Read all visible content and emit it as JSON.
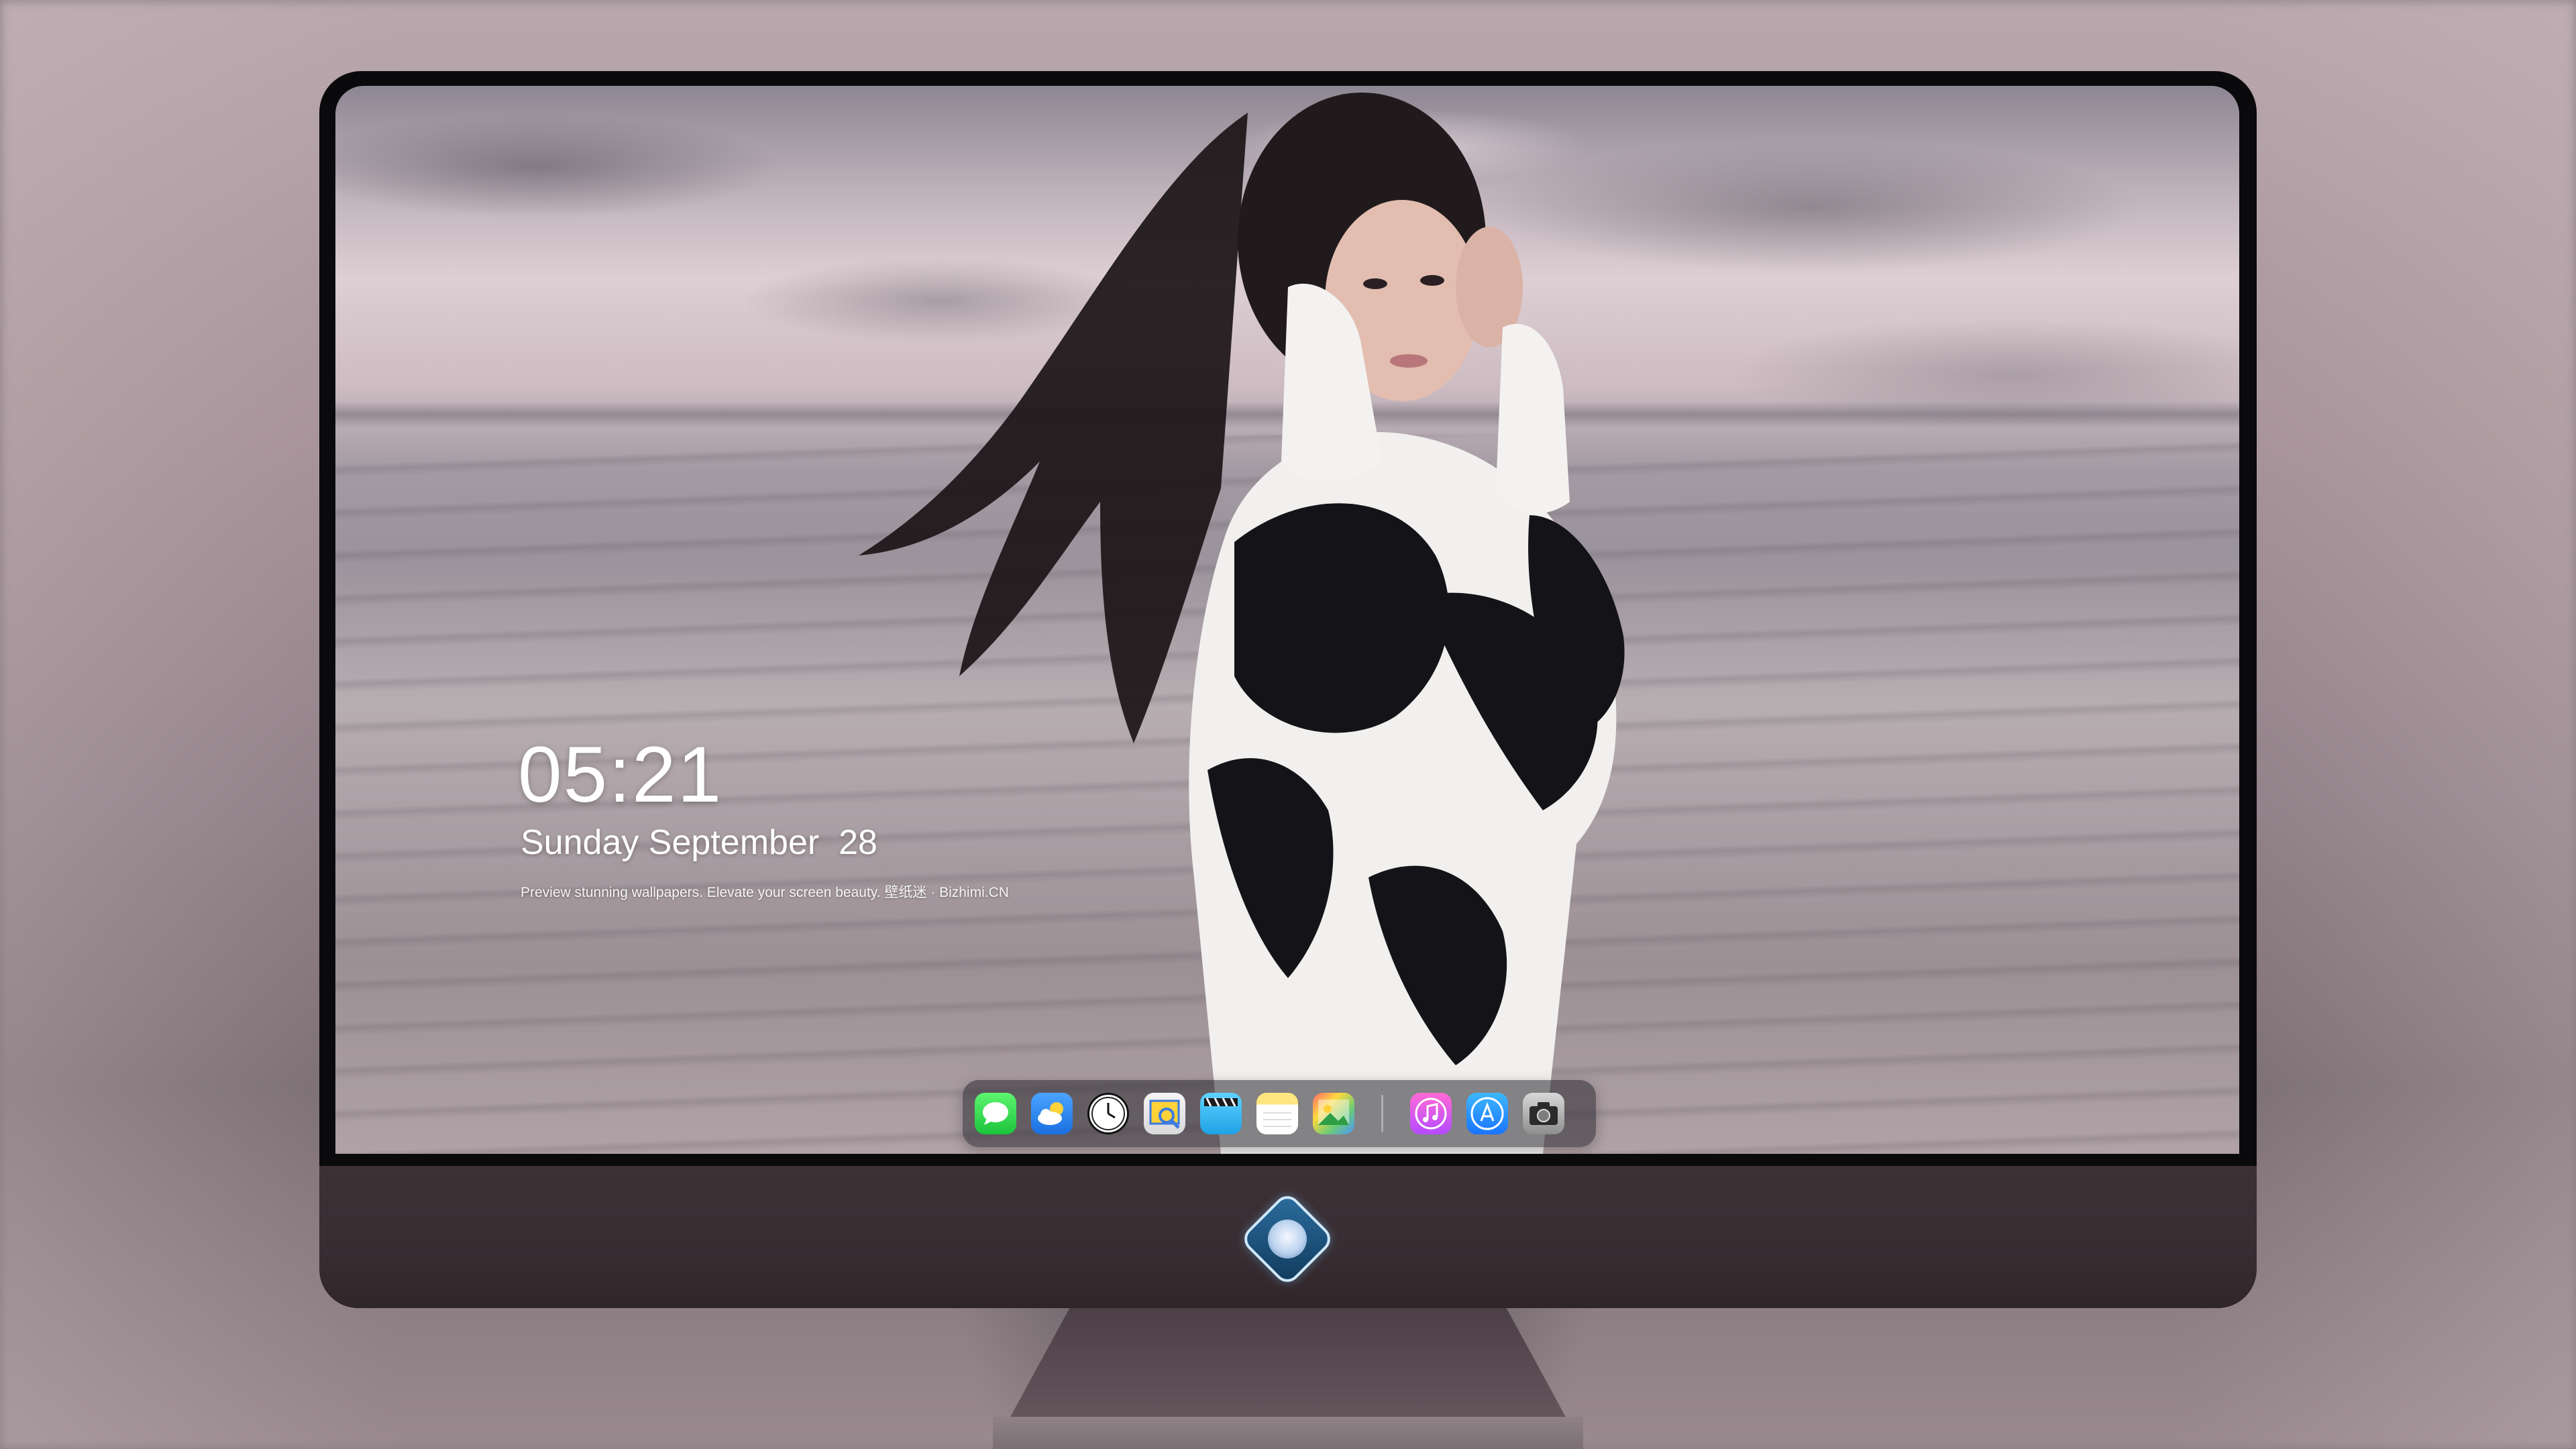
{
  "lock_screen": {
    "time": "05:21",
    "date": "Sunday September  28",
    "tagline": "Preview stunning wallpapers. Elevate your screen beauty. 壁纸迷 · Bizhimi.CN"
  },
  "dock": {
    "items": [
      {
        "name": "messages-icon"
      },
      {
        "name": "weather-icon"
      },
      {
        "name": "clock-icon"
      },
      {
        "name": "preview-icon"
      },
      {
        "name": "videos-icon"
      },
      {
        "name": "notes-icon"
      },
      {
        "name": "photos-icon"
      },
      {
        "name": "music-icon"
      },
      {
        "name": "app-store-icon"
      },
      {
        "name": "camera-icon"
      }
    ]
  },
  "colors": {
    "bezel": "#0a0a0c",
    "chin": "#3d3136",
    "text": "#ffffff",
    "dock_bg": "rgba(40,40,48,0.55)"
  }
}
